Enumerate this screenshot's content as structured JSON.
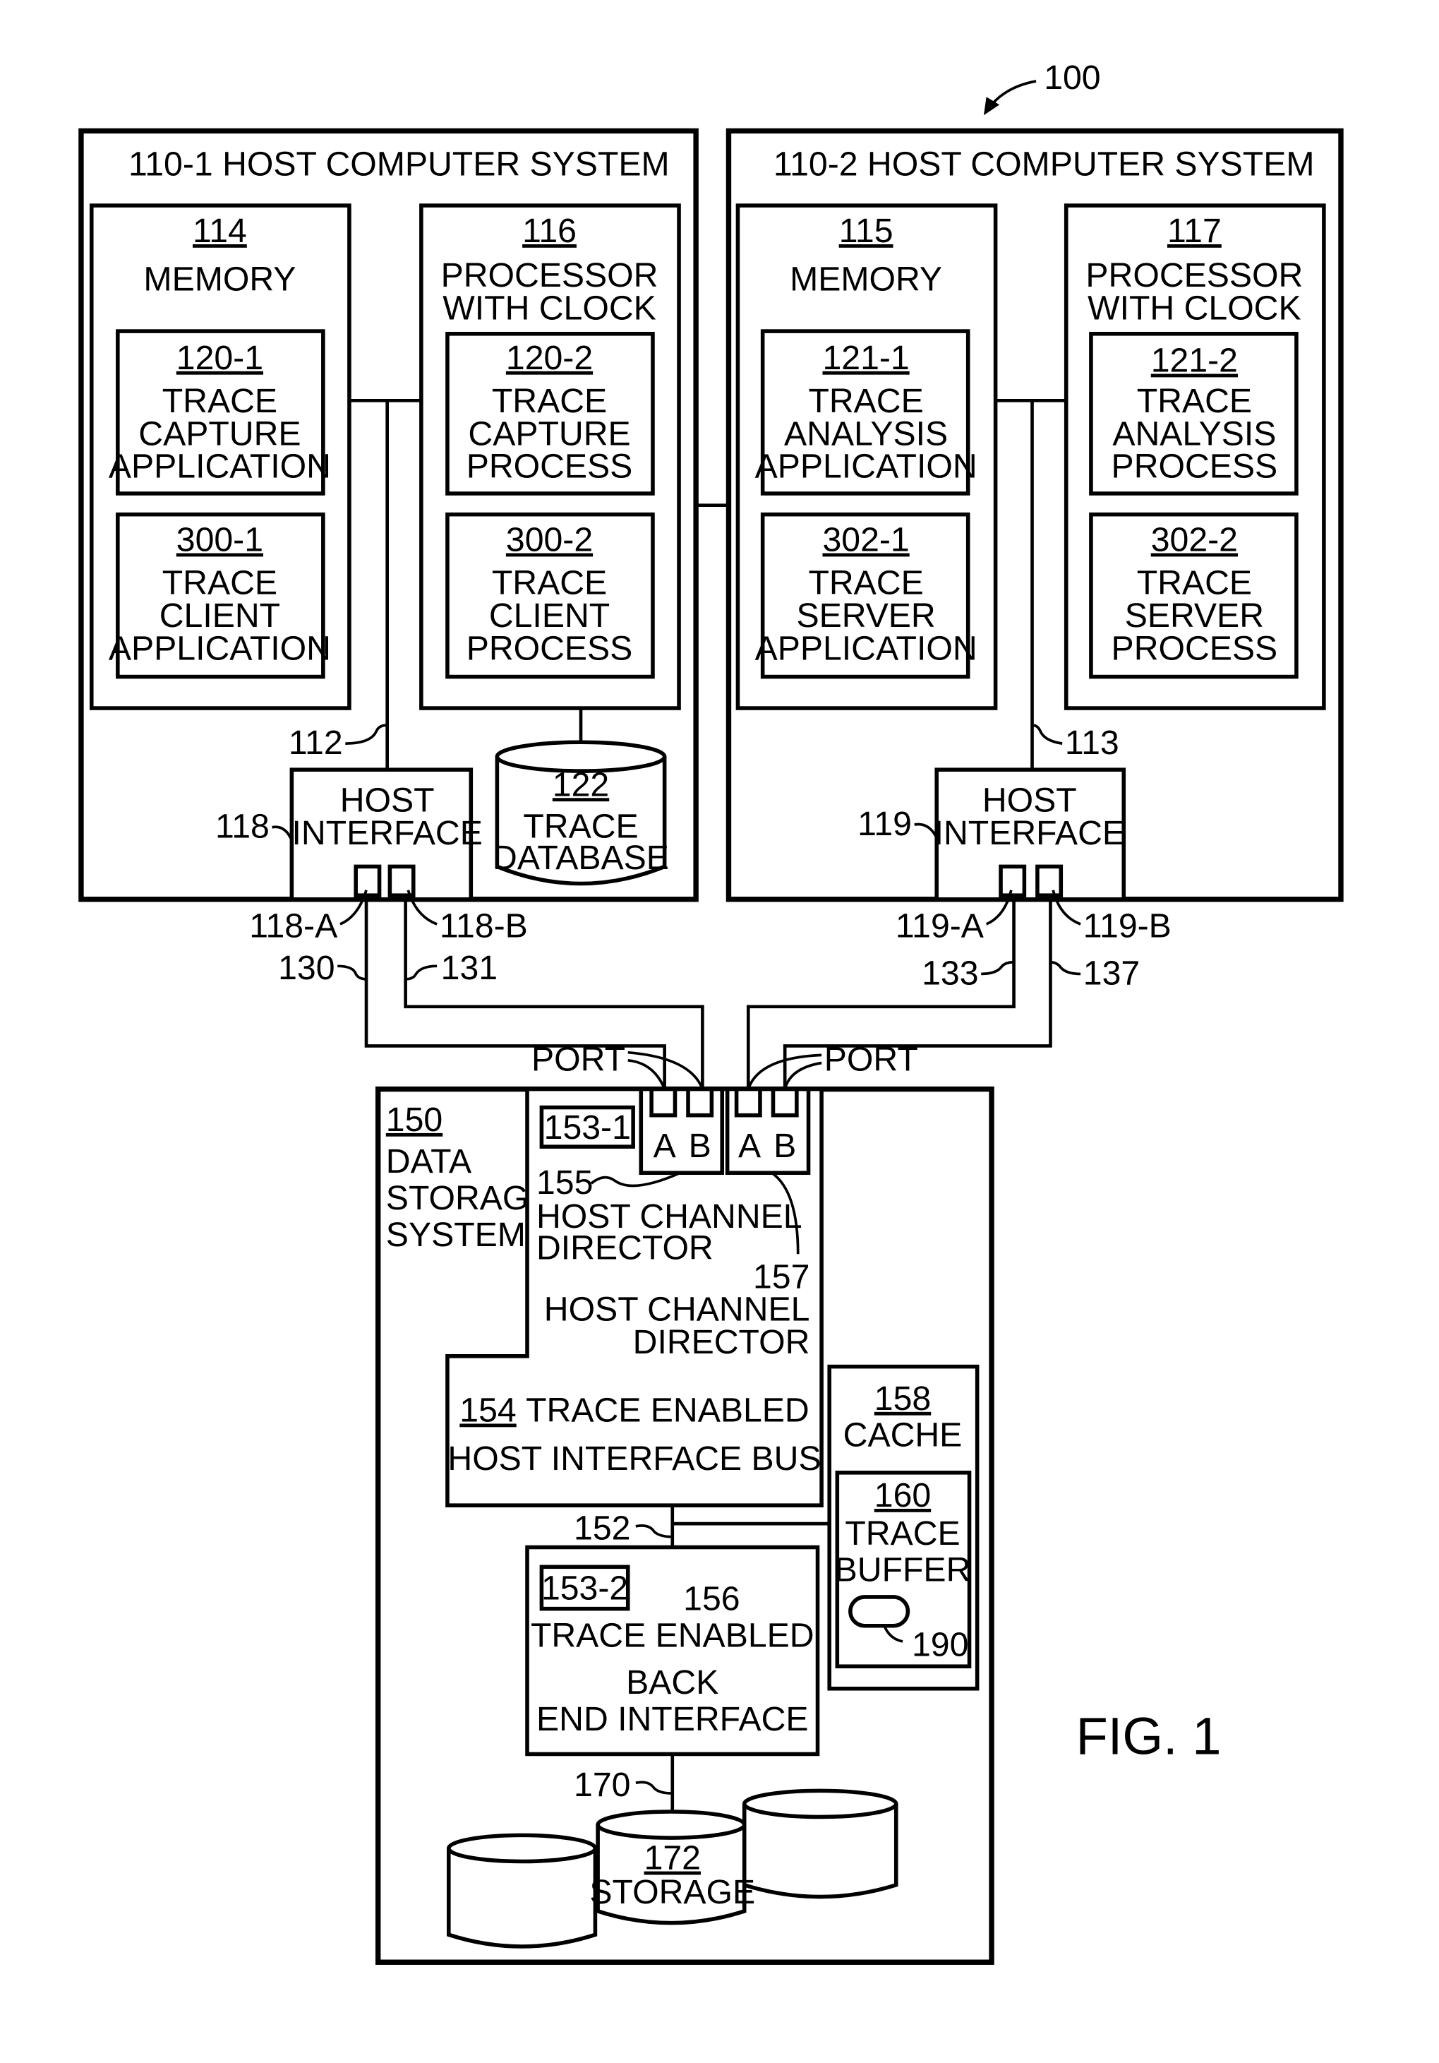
{
  "figure": {
    "ref": "100",
    "caption": "FIG. 1"
  },
  "host1": {
    "title": "110-1   HOST COMPUTER SYSTEM",
    "memory": {
      "ref": "114",
      "label": "MEMORY"
    },
    "processor": {
      "ref": "116",
      "line1": "PROCESSOR",
      "line2": "WITH CLOCK"
    },
    "trace_capture_app": {
      "ref": "120-1",
      "lines": [
        "TRACE",
        "CAPTURE",
        "APPLICATION"
      ]
    },
    "trace_client_app": {
      "ref": "300-1",
      "lines": [
        "TRACE",
        "CLIENT",
        "APPLICATION"
      ]
    },
    "trace_capture_proc": {
      "ref": "120-2",
      "lines": [
        "TRACE",
        "CAPTURE",
        "PROCESS"
      ]
    },
    "trace_client_proc": {
      "ref": "300-2",
      "lines": [
        "TRACE",
        "CLIENT",
        "PROCESS"
      ]
    },
    "bus_ref": "112",
    "host_interface": {
      "ref": "118",
      "line1": "HOST",
      "line2": "INTERFACE",
      "port_a": "118-A",
      "port_b": "118-B"
    },
    "database": {
      "ref": "122",
      "line1": "TRACE",
      "line2": "DATABASE"
    }
  },
  "host2": {
    "title": "110-2   HOST COMPUTER SYSTEM",
    "memory": {
      "ref": "115",
      "label": "MEMORY"
    },
    "processor": {
      "ref": "117",
      "line1": "PROCESSOR",
      "line2": "WITH CLOCK"
    },
    "trace_analysis_app": {
      "ref": "121-1",
      "lines": [
        "TRACE",
        "ANALYSIS",
        "APPLICATION"
      ]
    },
    "trace_server_app": {
      "ref": "302-1",
      "lines": [
        "TRACE",
        "SERVER",
        "APPLICATION"
      ]
    },
    "trace_analysis_proc": {
      "ref": "121-2",
      "lines": [
        "TRACE",
        "ANALYSIS",
        "PROCESS"
      ]
    },
    "trace_server_proc": {
      "ref": "302-2",
      "lines": [
        "TRACE",
        "SERVER",
        "PROCESS"
      ]
    },
    "bus_ref": "113",
    "host_interface": {
      "ref": "119",
      "line1": "HOST",
      "line2": "INTERFACE",
      "port_a": "119-A",
      "port_b": "119-B"
    }
  },
  "links": {
    "l130": "130",
    "l131": "131",
    "l133": "133",
    "l137": "137"
  },
  "storage_system": {
    "ref": "150",
    "lines": [
      "DATA",
      "STORAGE",
      "SYSTEM"
    ],
    "port_label_left": "PORT",
    "port_label_right": "PORT",
    "port_a": "A",
    "port_b": "B",
    "trace_ref_1": "153-1",
    "hcd1": {
      "ref": "155",
      "line1": "HOST CHANNEL",
      "line2": "DIRECTOR"
    },
    "hcd2": {
      "ref": "157",
      "line1": "HOST CHANNEL",
      "line2": "DIRECTOR"
    },
    "bus": {
      "ref": "154",
      "line1": "TRACE ENABLED",
      "line2": "HOST INTERFACE BUS"
    },
    "internal_bus_ref": "152",
    "cache": {
      "ref": "158",
      "label": "CACHE"
    },
    "trace_buffer": {
      "ref": "160",
      "line1": "TRACE",
      "line2": "BUFFER",
      "entry_ref": "190"
    },
    "back_end": {
      "trace_ref": "153-2",
      "ref": "156",
      "line1": "TRACE ENABLED",
      "line2": "BACK",
      "line3": "END INTERFACE"
    },
    "storage_bus_ref": "170",
    "storage": {
      "ref": "172",
      "label": "STORAGE"
    }
  }
}
